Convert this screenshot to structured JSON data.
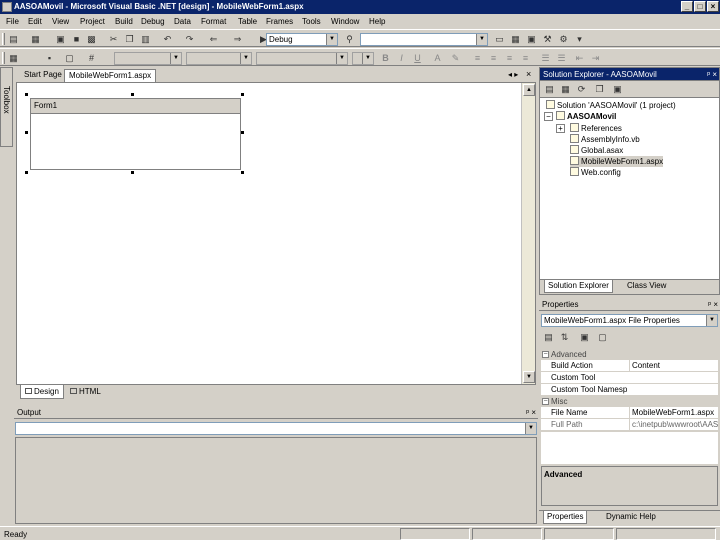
{
  "window": {
    "title": "AASOAMovil - Microsoft Visual Basic .NET [design] - MobileWebForm1.aspx"
  },
  "menu": [
    "File",
    "Edit",
    "View",
    "Project",
    "Build",
    "Debug",
    "Data",
    "Format",
    "Table",
    "Frames",
    "Tools",
    "Window",
    "Help"
  ],
  "toolbar": {
    "configuration": "Debug",
    "find_value": ""
  },
  "toolbox": {
    "label": "Toolbox"
  },
  "doc_tabs": [
    "Start Page",
    "MobileWebForm1.aspx"
  ],
  "designer": {
    "form_label": "Form1"
  },
  "view_tabs": [
    "Design",
    "HTML"
  ],
  "output": {
    "title": "Output",
    "pane_value": ""
  },
  "solution_explorer": {
    "title": "Solution Explorer - AASOAMovil",
    "items": [
      {
        "label": "Solution 'AASOAMovil' (1 project)",
        "level": 0,
        "bold": false
      },
      {
        "label": "AASOAMovil",
        "level": 1,
        "bold": true
      },
      {
        "label": "References",
        "level": 2,
        "bold": false
      },
      {
        "label": "AssemblyInfo.vb",
        "level": 2,
        "bold": false
      },
      {
        "label": "Global.asax",
        "level": 2,
        "bold": false
      },
      {
        "label": "MobileWebForm1.aspx",
        "level": 2,
        "bold": false
      },
      {
        "label": "Web.config",
        "level": 2,
        "bold": false
      }
    ],
    "tabs": [
      "Solution Explorer",
      "Class View"
    ]
  },
  "properties": {
    "title": "Properties",
    "object": "MobileWebForm1.aspx  File Properties",
    "categories": [
      {
        "name": "Advanced",
        "rows": [
          {
            "name": "Build Action",
            "value": "Content"
          },
          {
            "name": "Custom Tool",
            "value": ""
          },
          {
            "name": "Custom Tool Namespace",
            "value": ""
          }
        ]
      },
      {
        "name": "Misc",
        "rows": [
          {
            "name": "File Name",
            "value": "MobileWebForm1.aspx"
          },
          {
            "name": "Full Path",
            "value": "c:\\inetpub\\wwwroot\\AASO"
          }
        ]
      }
    ],
    "description_title": "Advanced",
    "tabs": [
      "Properties",
      "Dynamic Help"
    ]
  },
  "status": {
    "text": "Ready"
  }
}
